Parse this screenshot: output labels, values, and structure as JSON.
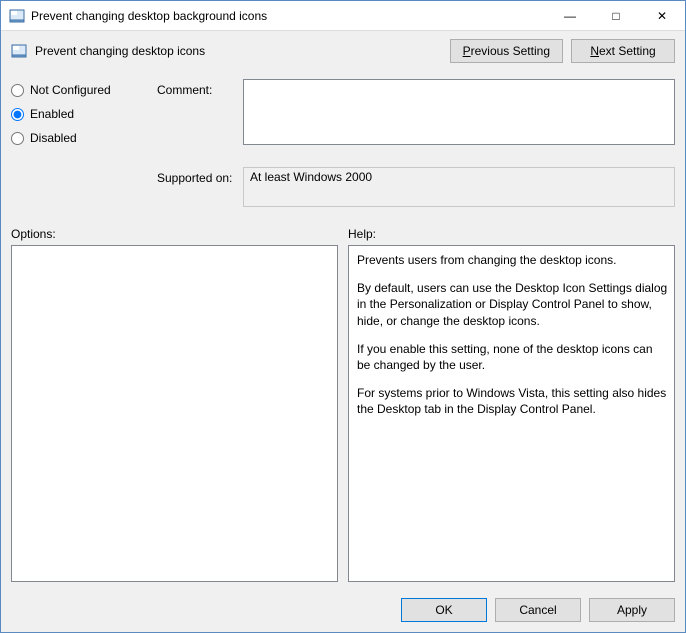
{
  "window": {
    "title": "Prevent changing desktop background icons",
    "controls": {
      "minimize": "—",
      "maximize": "□",
      "close": "✕"
    }
  },
  "header": {
    "policy_name": "Prevent changing desktop icons",
    "prev_prefix": "P",
    "prev_rest": "revious Setting",
    "next_prefix": "N",
    "next_rest": "ext Setting"
  },
  "config": {
    "not_configured_label": "Not Configured",
    "enabled_label": "Enabled",
    "disabled_label": "Disabled",
    "selected": "enabled",
    "comment_label": "Comment:",
    "comment_value": "",
    "supported_label": "Supported on:",
    "supported_value": "At least Windows 2000"
  },
  "panes": {
    "options_label": "Options:",
    "help_label": "Help:",
    "help_paragraphs": [
      "Prevents users from changing the desktop icons.",
      "By default, users can use the Desktop Icon Settings dialog in the Personalization or Display Control Panel to show, hide, or change the desktop icons.",
      "If you enable this setting, none of the desktop icons can be changed by the user.",
      "For systems prior to Windows Vista, this setting also hides the Desktop tab in the Display Control Panel."
    ]
  },
  "footer": {
    "ok": "OK",
    "cancel": "Cancel",
    "apply": "Apply"
  }
}
